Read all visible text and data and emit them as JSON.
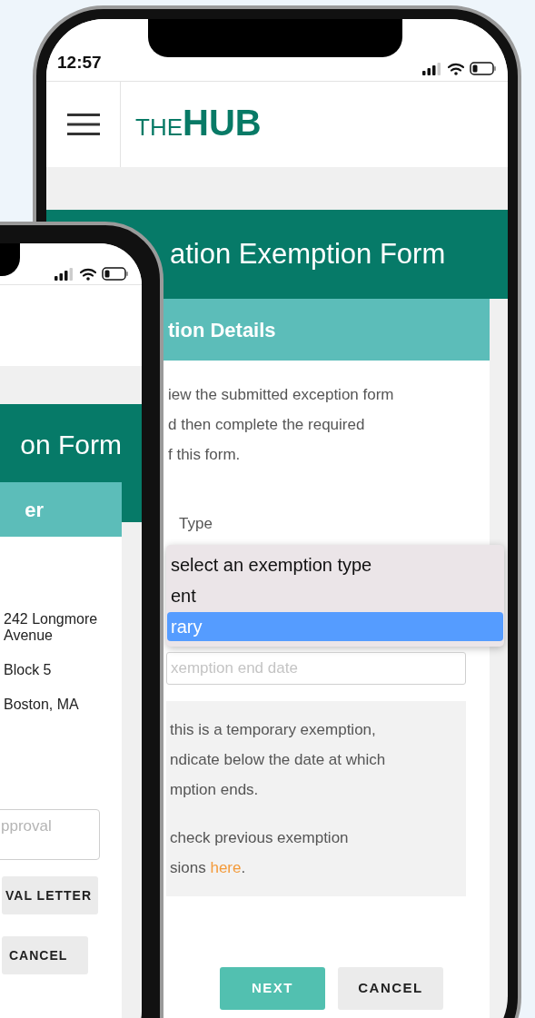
{
  "back_phone": {
    "status_time": "12:57",
    "logo": {
      "prefix": "THE",
      "main": "HUB"
    },
    "banner_title": "ation Exemption Form",
    "section_title": "tion Details",
    "intro_lines": [
      "iew the submitted exception form",
      "d then complete the required",
      "f this form."
    ],
    "field_label": "Type",
    "dropdown": {
      "options": [
        {
          "label": "select an exemption type",
          "selected": false
        },
        {
          "label": "ent",
          "selected": false
        },
        {
          "label": "rary",
          "selected": true
        }
      ]
    },
    "end_date": {
      "placeholder": "xemption end date"
    },
    "info_paragraphs": [
      [
        {
          "text": "this is a temporary exemption,"
        },
        {
          "text": "ndicate below the date at which"
        },
        {
          "text": "mption ends."
        }
      ],
      [
        {
          "text": "check previous exemption"
        },
        {
          "text": "sions ",
          "link": "here",
          "end": "."
        }
      ]
    ],
    "buttons": [
      {
        "label": "NEXT",
        "kind": "primary"
      },
      {
        "label": "CANCEL",
        "kind": "secondary"
      }
    ]
  },
  "front_phone": {
    "banner_title": "on Form",
    "section_title": "er",
    "address_lines": [
      "242 Longmore Avenue",
      "Block 5",
      "Boston, MA"
    ],
    "approval_field": {
      "placeholder": "pproval"
    },
    "buttons": [
      {
        "label": "VAL LETTER",
        "kind": "secondary"
      },
      {
        "label": "CANCEL",
        "kind": "secondary"
      }
    ]
  }
}
